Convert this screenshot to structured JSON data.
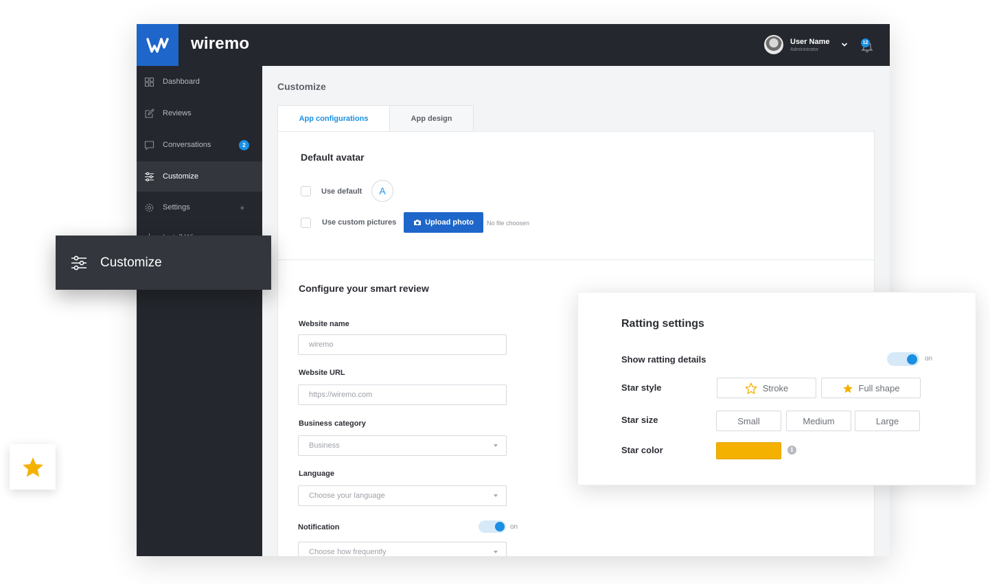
{
  "brand": {
    "name": "wiremo",
    "color": "#1e66c9"
  },
  "user": {
    "name": "User Name",
    "role": "Administrator",
    "notifications": "12"
  },
  "sidebar": {
    "items": [
      {
        "label": "Dashboard",
        "icon": "grid-icon"
      },
      {
        "label": "Reviews",
        "icon": "edit-icon"
      },
      {
        "label": "Conversations",
        "icon": "chat-icon",
        "badge": "2"
      },
      {
        "label": "Customize",
        "icon": "sliders-icon",
        "active": true
      },
      {
        "label": "Settings",
        "icon": "gear-icon"
      },
      {
        "label": "Install Wiremo",
        "icon": "install-icon"
      }
    ]
  },
  "page": {
    "title": "Customize"
  },
  "tabs": [
    {
      "label": "App configurations",
      "active": true
    },
    {
      "label": "App design"
    }
  ],
  "avatar_section": {
    "title": "Default avatar",
    "use_default_label": "Use default",
    "avatar_letter": "A",
    "use_custom_label": "Use custom pictures",
    "upload_label": "Upload photo",
    "no_file_text": "No file choosen"
  },
  "smart_review": {
    "title": "Configure your smart review",
    "website_name": {
      "label": "Website name",
      "placeholder": "wiremo"
    },
    "website_url": {
      "label": "Website URL",
      "placeholder": "https://wiremo.com"
    },
    "business_category": {
      "label": "Business category",
      "value": "Business"
    },
    "language": {
      "label": "Language",
      "value": "Choose your language"
    },
    "notification": {
      "label": "Notification",
      "toggle": "on",
      "value": "Choose how frequently"
    }
  },
  "floating_card": {
    "label": "Customize"
  },
  "rating": {
    "title": "Ratting settings",
    "show_details_label": "Show ratting details",
    "show_details_toggle": "on",
    "star_style_label": "Star style",
    "star_style_options": [
      "Stroke",
      "Full shape"
    ],
    "star_size_label": "Star size",
    "star_size_options": [
      "Small",
      "Medium",
      "Large"
    ],
    "star_color_label": "Star color",
    "star_color": "#f5b100"
  },
  "colors": {
    "accent": "#1a8fe3",
    "dark": "#24272d",
    "star": "#f5b100"
  }
}
